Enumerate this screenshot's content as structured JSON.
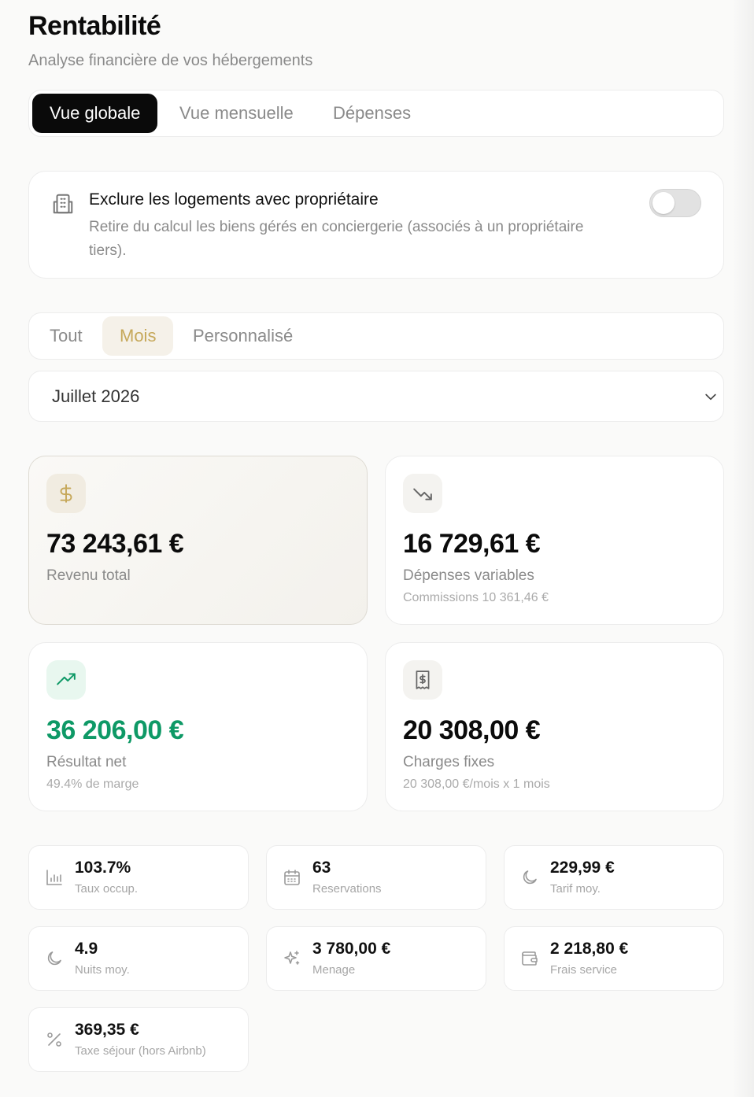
{
  "page": {
    "title": "Rentabilité",
    "subtitle": "Analyse financière de vos hébergements"
  },
  "main_tabs": [
    {
      "label": "Vue globale",
      "active": true
    },
    {
      "label": "Vue mensuelle",
      "active": false
    },
    {
      "label": "Dépenses",
      "active": false
    }
  ],
  "owner_filter": {
    "icon": "building-icon",
    "title": "Exclure les logements avec propriétaire",
    "description": "Retire du calcul les biens gérés en conciergerie (associés à un propriétaire tiers).",
    "enabled": false
  },
  "period_tabs": [
    {
      "label": "Tout",
      "active": false
    },
    {
      "label": "Mois",
      "active": true
    },
    {
      "label": "Personnalisé",
      "active": false
    }
  ],
  "month_select": {
    "value": "Juillet 2026"
  },
  "stats": {
    "revenue": {
      "icon": "dollar-icon",
      "amount": "73 243,61 €",
      "label": "Revenu total"
    },
    "variable_expenses": {
      "icon": "trending-down-icon",
      "amount": "16 729,61 €",
      "label": "Dépenses variables",
      "sub": "Commissions 10 361,46 €"
    },
    "net_result": {
      "icon": "trending-up-icon",
      "amount": "36 206,00 €",
      "label": "Résultat net",
      "sub": "49.4% de marge"
    },
    "fixed_charges": {
      "icon": "receipt-icon",
      "amount": "20 308,00 €",
      "label": "Charges fixes",
      "sub": "20 308,00 €/mois x 1 mois"
    }
  },
  "metrics": [
    {
      "icon": "bar-chart-icon",
      "value": "103.7%",
      "label": "Taux occup."
    },
    {
      "icon": "calendar-icon",
      "value": "63",
      "label": "Reservations"
    },
    {
      "icon": "moon-icon",
      "value": "229,99 €",
      "label": "Tarif moy."
    },
    {
      "icon": "moon-icon",
      "value": "4.9",
      "label": "Nuits moy."
    },
    {
      "icon": "sparkles-icon",
      "value": "3 780,00 €",
      "label": "Menage"
    },
    {
      "icon": "wallet-icon",
      "value": "2 218,80 €",
      "label": "Frais service"
    },
    {
      "icon": "percent-icon",
      "value": "369,35 €",
      "label": "Taxe séjour (hors Airbnb)"
    }
  ],
  "colors": {
    "accent_gold": "#c6a85a",
    "positive_green": "#0e9966",
    "active_tab_bg": "#0a0a0a"
  }
}
